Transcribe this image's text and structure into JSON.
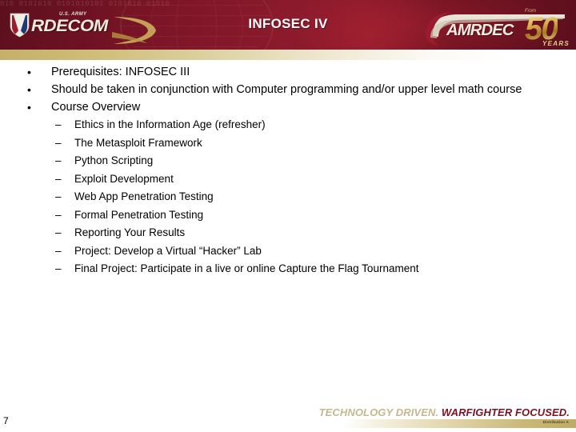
{
  "header": {
    "title": "INFOSEC IV",
    "background_color": "#7c1527",
    "gold_accent_color": "#c4b06a",
    "digits_texture": "010 0101010 0101010101 0101010 01010",
    "rdecom_logo": {
      "army_label": "U.S. ARMY",
      "wordmark": "RDECOM",
      "shield_icon": "rdecom-shield-icon",
      "swoosh_icon": "rdecom-swoosh-icon"
    },
    "amrdec_logo": {
      "from_label": "From",
      "wordmark": "AMRDEC",
      "anniversary": "50",
      "years_label": "YEARS",
      "sweep_icon": "amrdec-sweep-icon"
    }
  },
  "body": {
    "bullets": [
      {
        "text": "Prerequisites: INFOSEC III",
        "sub": []
      },
      {
        "text": "Should be taken in conjunction with Computer programming and/or upper level math course",
        "sub": []
      },
      {
        "text": "Course Overview",
        "sub": [
          "Ethics in the Information Age (refresher)",
          "The Metasploit Framework",
          "Python Scripting",
          "Exploit Development",
          "Web App Penetration Testing",
          "Formal Penetration Testing",
          "Reporting Your Results",
          "Project: Develop a Virtual “Hacker” Lab",
          "Final Project: Participate in a live or online Capture the Flag Tournament"
        ]
      }
    ]
  },
  "footer": {
    "page_number": "7",
    "tagline_light": "TECHNOLOGY DRIVEN.",
    "tagline_dark": "WARFIGHTER FOCUSED.",
    "fine_print": "Distribution A",
    "tagline_light_color": "#c5b78e",
    "tagline_dark_color": "#7d1025"
  }
}
